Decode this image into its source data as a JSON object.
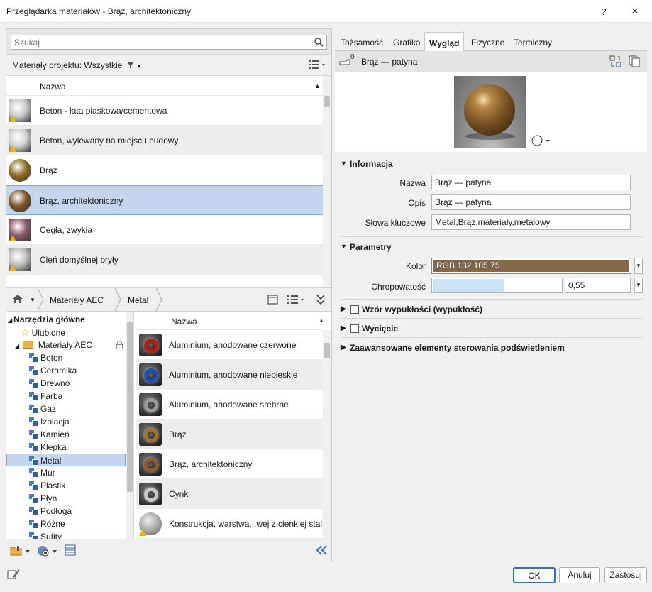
{
  "window": {
    "title": "Przeglądarka materiałów - Brąz, architektoniczny",
    "help": "?",
    "close": "✕"
  },
  "search": {
    "placeholder": "Szukaj"
  },
  "project": {
    "label": "Materiały projektu: Wszystkie"
  },
  "project_list": {
    "column": "Nazwa",
    "rows": [
      {
        "name": "Beton - łata piaskowa/cementowa",
        "thumb": "#c9c9c9",
        "warn": true
      },
      {
        "name": "Beton, wylewany na miejscu budowy",
        "thumb": "#d0d0d0",
        "warn": true
      },
      {
        "name": "Brąz",
        "thumb": "#8a6a24",
        "warn": false
      },
      {
        "name": "Brąz, architektoniczny",
        "thumb": "#7a5428",
        "warn": false
      },
      {
        "name": "Cegła, zwykła",
        "thumb": "#8c5a6c",
        "warn": true
      },
      {
        "name": "Cień domyślnej bryły",
        "thumb": "#bdbdbd",
        "warn": true
      }
    ]
  },
  "breadcrumb": {
    "home": "home",
    "level1": "Materiały AEC",
    "level2": "Metal"
  },
  "tree": {
    "root": "Narzędzia główne",
    "favorites": "Ulubione",
    "library": "Materiały AEC",
    "items": [
      "Beton",
      "Ceramika",
      "Drewno",
      "Farba",
      "Gaz",
      "Izolacja",
      "Kamień",
      "Klepka",
      "Metal",
      "Mur",
      "Plastik",
      "Płyn",
      "Podłoga",
      "Różne",
      "Sufity"
    ]
  },
  "library_list": {
    "column": "Nazwa",
    "rows": [
      {
        "name": "Aluminium, anodowane czerwone",
        "color": "#c01818"
      },
      {
        "name": "Aluminium, anodowane niebieskie",
        "color": "#1a4fb8"
      },
      {
        "name": "Aluminium, anodowane srebrne",
        "color": "#9a9a9a"
      },
      {
        "name": "Brąz",
        "color": "#a07030"
      },
      {
        "name": "Brąz, architektoniczny",
        "color": "#8a5a2a"
      },
      {
        "name": "Cynk",
        "color": "#c8c8c8"
      },
      {
        "name": "Konstrukcja, warstwa...wej z cienkiej stali",
        "color": "#bcbcbc"
      }
    ]
  },
  "tabs": [
    "Tożsamość",
    "Grafika",
    "Wygląd",
    "Fizyczne",
    "Termiczny"
  ],
  "active_tab": "Wygląd",
  "asset": {
    "count": "0",
    "name": "Brąz — patyna"
  },
  "info": {
    "header": "Informacja",
    "name_label": "Nazwa",
    "name_value": "Brąz — patyna",
    "desc_label": "Opis",
    "desc_value": "Brąz — patyna",
    "kw_label": "Słowa kluczowe",
    "kw_value": "Metal,Brąz,materiały,metalowy"
  },
  "params": {
    "header": "Parametry",
    "color_label": "Kolor",
    "color_value": "RGB 132 105 75",
    "color_hex": "#84694b",
    "rough_label": "Chropowatość",
    "rough_value": "0,55",
    "rough_fraction": 0.55
  },
  "sections": {
    "bump": "Wzór wypukłości (wypukłość)",
    "cutout": "Wycięcie",
    "advanced": "Zaawansowane elementy sterowania podświetleniem"
  },
  "footer": {
    "ok": "OK",
    "cancel": "Anuluj",
    "apply": "Zastosuj"
  }
}
